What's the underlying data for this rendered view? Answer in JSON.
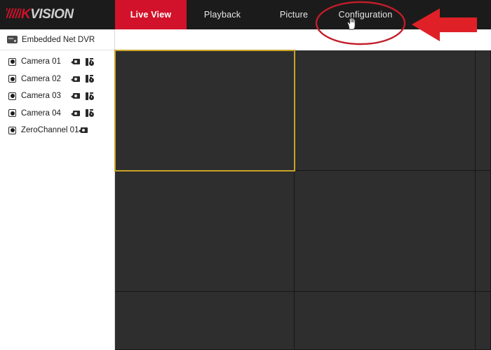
{
  "header": {
    "logo_hik": "HIK",
    "logo_vision": "VISION",
    "tabs": [
      {
        "label": "Live View",
        "active": true
      },
      {
        "label": "Playback",
        "active": false
      },
      {
        "label": "Picture",
        "active": false
      },
      {
        "label": "Configuration",
        "active": false
      }
    ]
  },
  "sidebar": {
    "device": {
      "label": "Embedded Net DVR",
      "icon": "dvr-icon"
    },
    "cameras": [
      {
        "label": "Camera 01",
        "capture": true,
        "record": true
      },
      {
        "label": "Camera 02",
        "capture": true,
        "record": true
      },
      {
        "label": "Camera 03",
        "capture": true,
        "record": true
      },
      {
        "label": "Camera 04",
        "capture": true,
        "record": true
      },
      {
        "label": "ZeroChannel 01",
        "capture": true,
        "record": false
      }
    ]
  },
  "video": {
    "layout": "3x3",
    "selected_cell_index": 0,
    "cell_background": "#2e2e2e",
    "selected_border_color": "#c9a227"
  },
  "annotations": {
    "ellipse_target": "Configuration",
    "arrow_direction": "left",
    "annotation_color": "#d81f2a",
    "cursor": "hand-pointer"
  },
  "colors": {
    "header_bg": "#1b1b1b",
    "accent_red": "#d2122a",
    "sidebar_bg": "#ffffff",
    "video_bg": "#2e2e2e"
  }
}
